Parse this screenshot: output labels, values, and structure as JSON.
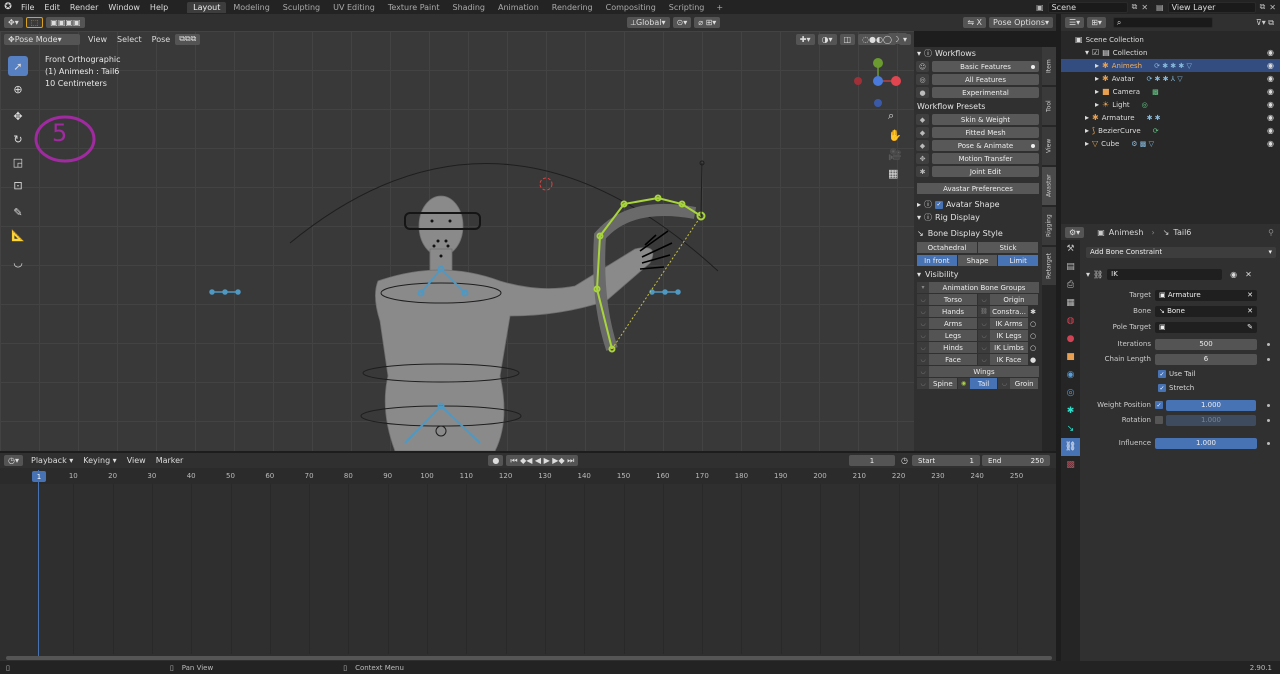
{
  "menu": [
    "File",
    "Edit",
    "Render",
    "Window",
    "Help"
  ],
  "workspaces": [
    {
      "label": "Layout",
      "active": true
    },
    {
      "label": "Modeling"
    },
    {
      "label": "Sculpting"
    },
    {
      "label": "UV Editing"
    },
    {
      "label": "Texture Paint"
    },
    {
      "label": "Shading"
    },
    {
      "label": "Animation"
    },
    {
      "label": "Rendering"
    },
    {
      "label": "Compositing"
    },
    {
      "label": "Scripting"
    }
  ],
  "top_right": {
    "scene": "Scene",
    "view_layer": "View Layer"
  },
  "viewport_header": {
    "mode": "Pose Mode",
    "menus": [
      "View",
      "Select",
      "Pose"
    ],
    "transform": "Global",
    "pose_options": "Pose Options"
  },
  "viewport_info": {
    "line1": "Front Orthographic",
    "line2": "(1) Animesh : Tail6",
    "line3": "10 Centimeters"
  },
  "annotation_number": "5",
  "npanel": {
    "workflows_title": "Workflows",
    "workflows": [
      "Basic Features",
      "All Features",
      "Experimental"
    ],
    "presets_title": "Workflow Presets",
    "presets": [
      "Skin & Weight",
      "Fitted Mesh",
      "Pose & Animate",
      "Motion Transfer",
      "Joint Edit"
    ],
    "avastar_prefs": "Avastar Preferences",
    "avatar_shape": "Avatar Shape",
    "rig_display": "Rig Display",
    "bone_display_style": "Bone Display Style",
    "style_a": "Octahedral",
    "style_b": "Stick",
    "in_front": "In front",
    "shape": "Shape",
    "limit": "Limit",
    "visibility": "Visibility",
    "anim_bone_groups": "Animation Bone Groups",
    "groups": [
      [
        "Torso",
        "Origin"
      ],
      [
        "Hands",
        "Constra..."
      ],
      [
        "Arms",
        "IK Arms"
      ],
      [
        "Legs",
        "IK Legs"
      ],
      [
        "Hinds",
        "IK Limbs"
      ],
      [
        "Face",
        "IK Face"
      ]
    ],
    "wings": "Wings",
    "last_row": [
      "Spine",
      "Tail",
      "Groin"
    ],
    "tabs": [
      "Item",
      "Tool",
      "View",
      "Avastar",
      "Rigging",
      "Retarget"
    ]
  },
  "outliner": {
    "root": "Scene Collection",
    "collection": "Collection",
    "items": [
      "Animesh",
      "Avatar",
      "Camera",
      "Light",
      "Armature",
      "BezierCurve",
      "Cube"
    ]
  },
  "properties": {
    "object": "Animesh",
    "bone": "Tail6",
    "add_constraint": "Add Bone Constraint",
    "constraint_name": "IK",
    "target_label": "Target",
    "target_value": "Armature",
    "bone_label": "Bone",
    "bone_value": "Bone",
    "pole_label": "Pole Target",
    "iterations_label": "Iterations",
    "iterations_value": "500",
    "chain_label": "Chain Length",
    "chain_value": "6",
    "use_tail": "Use Tail",
    "stretch": "Stretch",
    "weight_pos_label": "Weight Position",
    "weight_pos_value": "1.000",
    "rotation_label": "Rotation",
    "rotation_value": "1.000",
    "influence_label": "Influence",
    "influence_value": "1.000"
  },
  "timeline": {
    "menus": [
      "Playback",
      "Keying",
      "View",
      "Marker"
    ],
    "current_frame": "1",
    "start_label": "Start",
    "start": "1",
    "end_label": "End",
    "end": "250",
    "ticks": [
      "10",
      "20",
      "30",
      "40",
      "50",
      "60",
      "70",
      "80",
      "90",
      "100",
      "110",
      "120",
      "130",
      "140",
      "150",
      "160",
      "170",
      "180",
      "190",
      "200",
      "210",
      "220",
      "230",
      "240",
      "250"
    ],
    "playhead": "1"
  },
  "status": {
    "pan": "Pan View",
    "context": "Context Menu",
    "version": "2.90.1"
  },
  "colors": {
    "accent": "#4772b3",
    "selection": "#334d80",
    "bone_active": "#a8d43c",
    "annotation": "#a02aa0"
  }
}
